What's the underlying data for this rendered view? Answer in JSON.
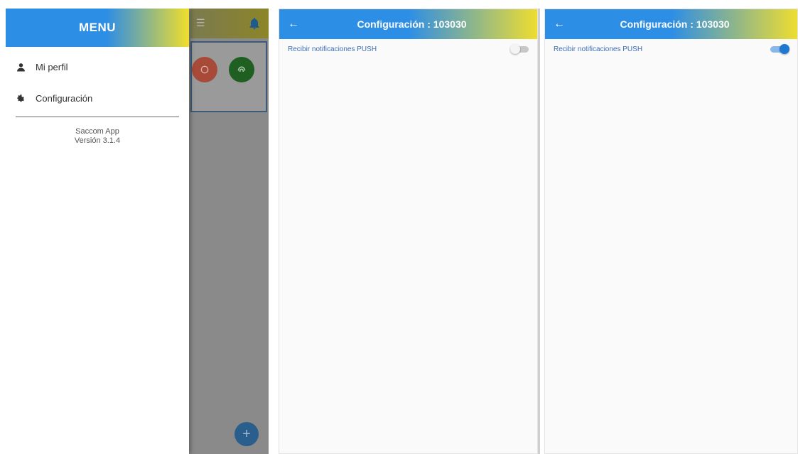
{
  "menu_screen": {
    "drawer_title": "MENU",
    "items": [
      {
        "label": "Mi perfil",
        "icon": "person-icon"
      },
      {
        "label": "Configuración",
        "icon": "gear-icon"
      }
    ],
    "app_name": "Saccom App",
    "app_version": "Versión 3.1.4",
    "background": {
      "menu_glyph": "☰",
      "fab_glyph": "+",
      "accent_blue": "#2d8ee6",
      "accent_yellow": "#f0de2b"
    }
  },
  "config_off": {
    "back_glyph": "←",
    "title": "Configuración : 103030",
    "setting_label": "Recibir notificaciones PUSH",
    "push_enabled": false
  },
  "config_on": {
    "back_glyph": "←",
    "title": "Configuración : 103030",
    "setting_label": "Recibir notificaciones PUSH",
    "push_enabled": true
  },
  "colors": {
    "appbar_gradient_start": "#2d8ee6",
    "appbar_gradient_end": "#eedd30",
    "label_blue": "#3c6fb4",
    "switch_on": "#1f78d1"
  }
}
